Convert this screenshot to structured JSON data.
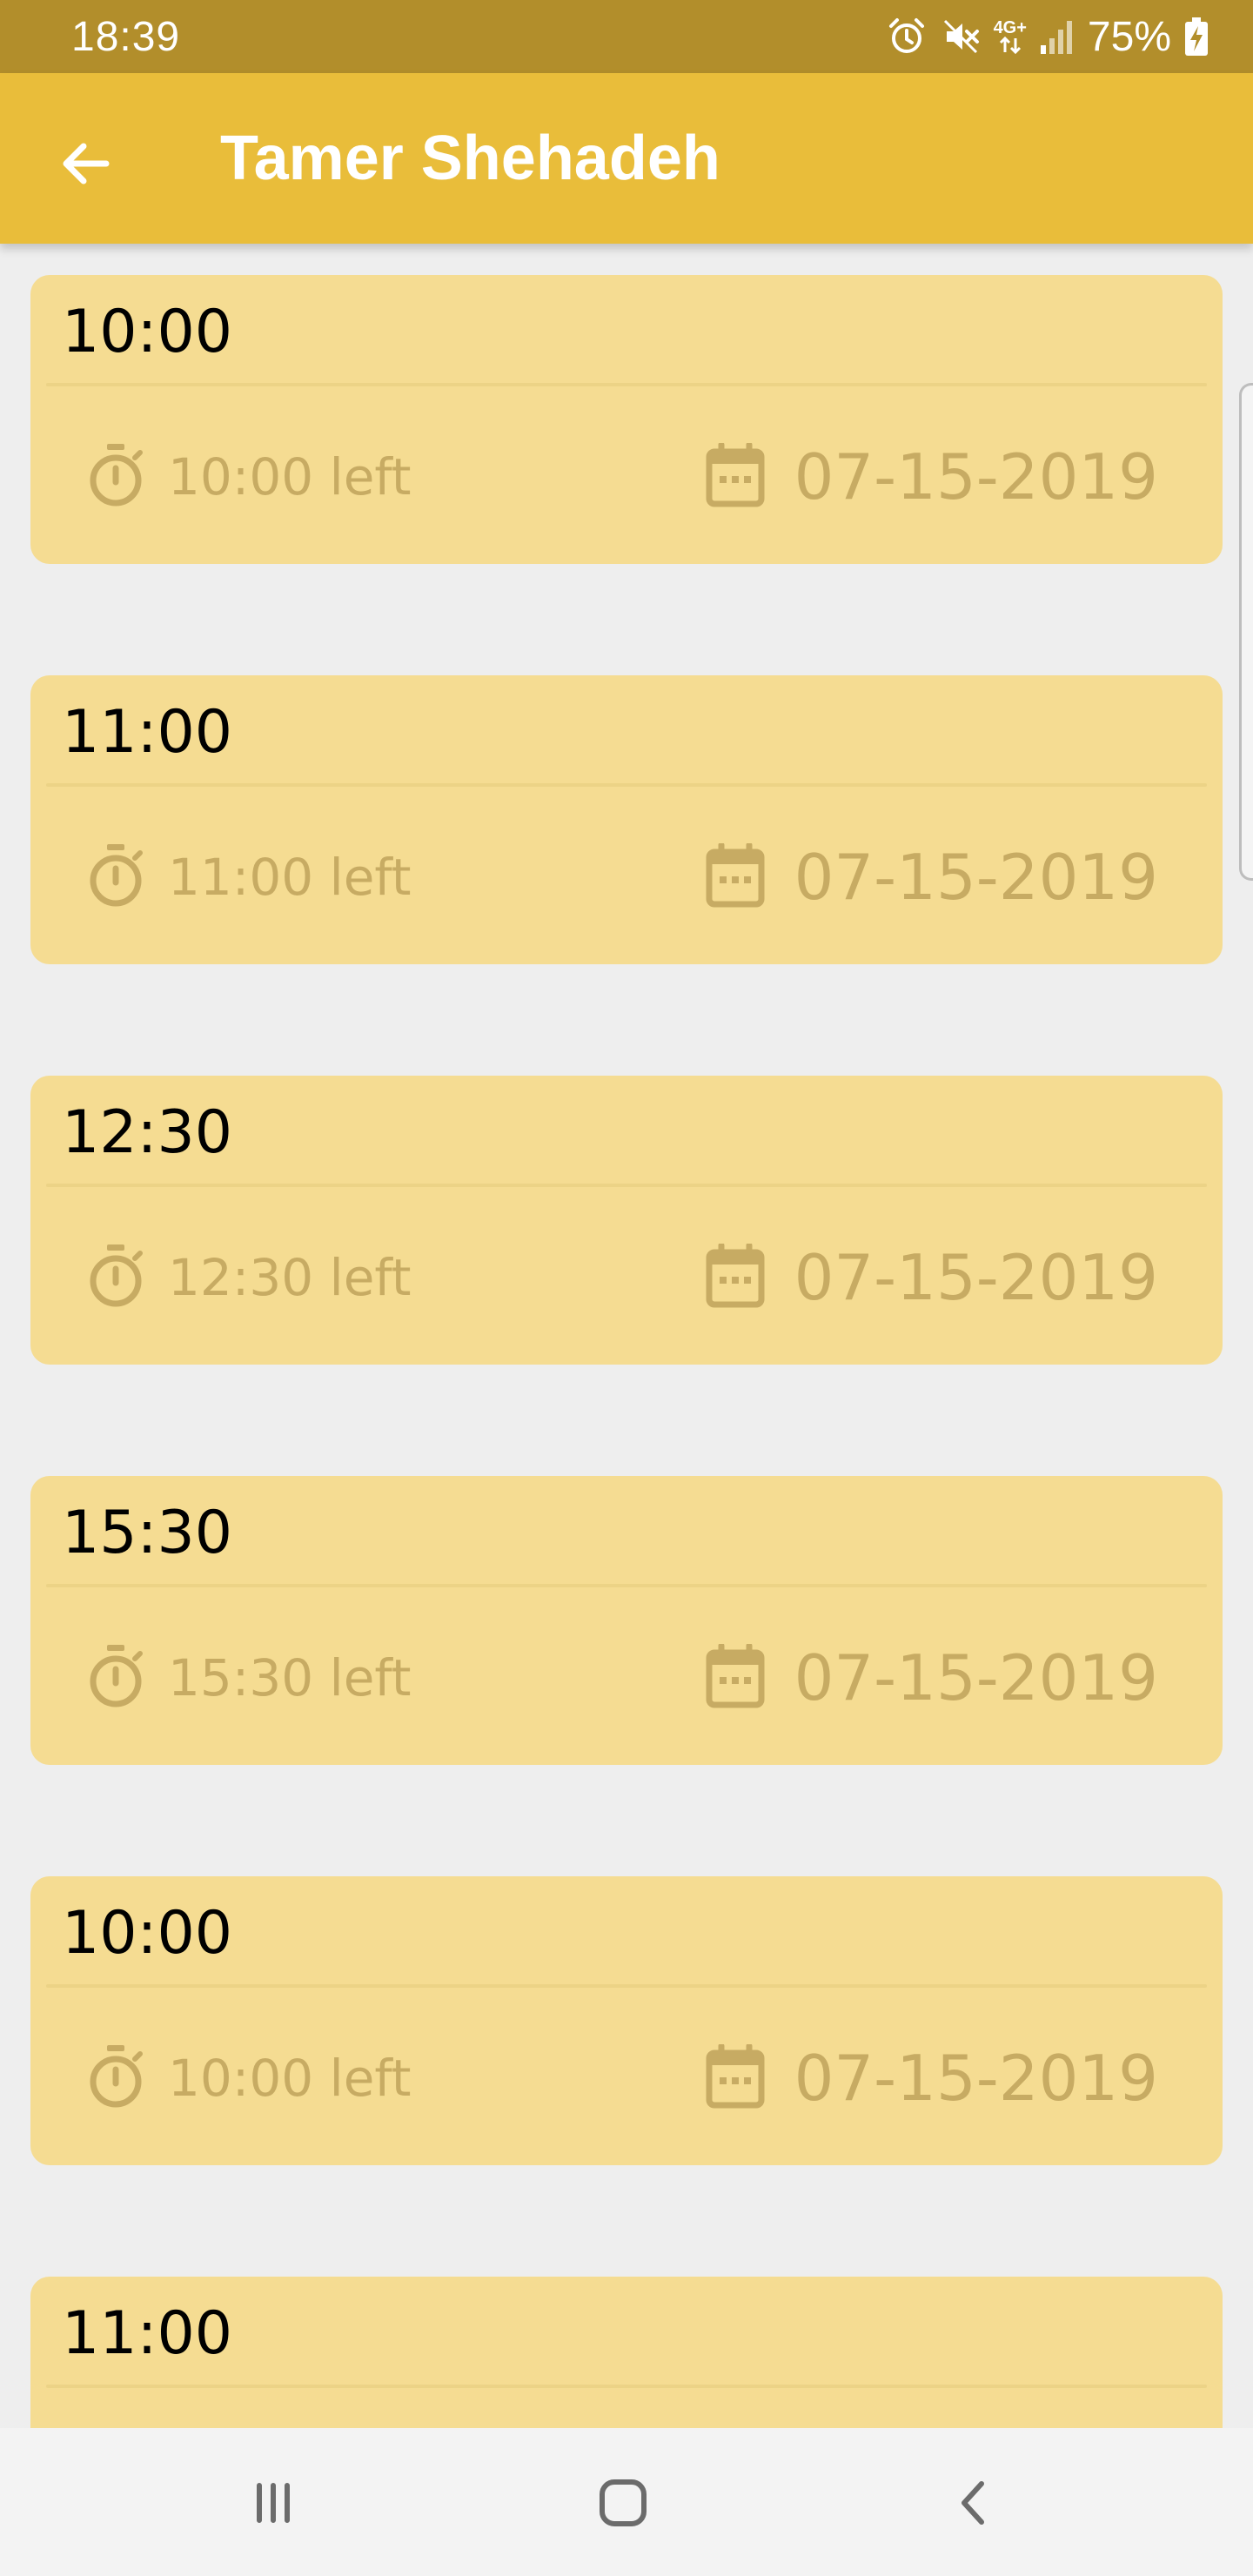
{
  "status_bar": {
    "time": "18:39",
    "network_label": "4G+",
    "battery_percent": "75%"
  },
  "app_bar": {
    "title": "Tamer Shehadeh"
  },
  "appointments": [
    {
      "time": "10:00",
      "remaining": "10:00 left",
      "date": "07-15-2019"
    },
    {
      "time": "11:00",
      "remaining": "11:00 left",
      "date": "07-15-2019"
    },
    {
      "time": "12:30",
      "remaining": "12:30 left",
      "date": "07-15-2019"
    },
    {
      "time": "15:30",
      "remaining": "15:30 left",
      "date": "07-15-2019"
    },
    {
      "time": "10:00",
      "remaining": "10:00 left",
      "date": "07-15-2019"
    },
    {
      "time": "11:00",
      "remaining": "",
      "date": ""
    }
  ],
  "colors": {
    "status_bar": "#b28e2b",
    "app_bar": "#e9bd3a",
    "card_background": "#f5dc92",
    "muted_text": "#c7ab63",
    "page_background": "#eeeeee"
  },
  "icons": {
    "card_left": "stopwatch-icon",
    "card_right": "calendar-icon"
  }
}
